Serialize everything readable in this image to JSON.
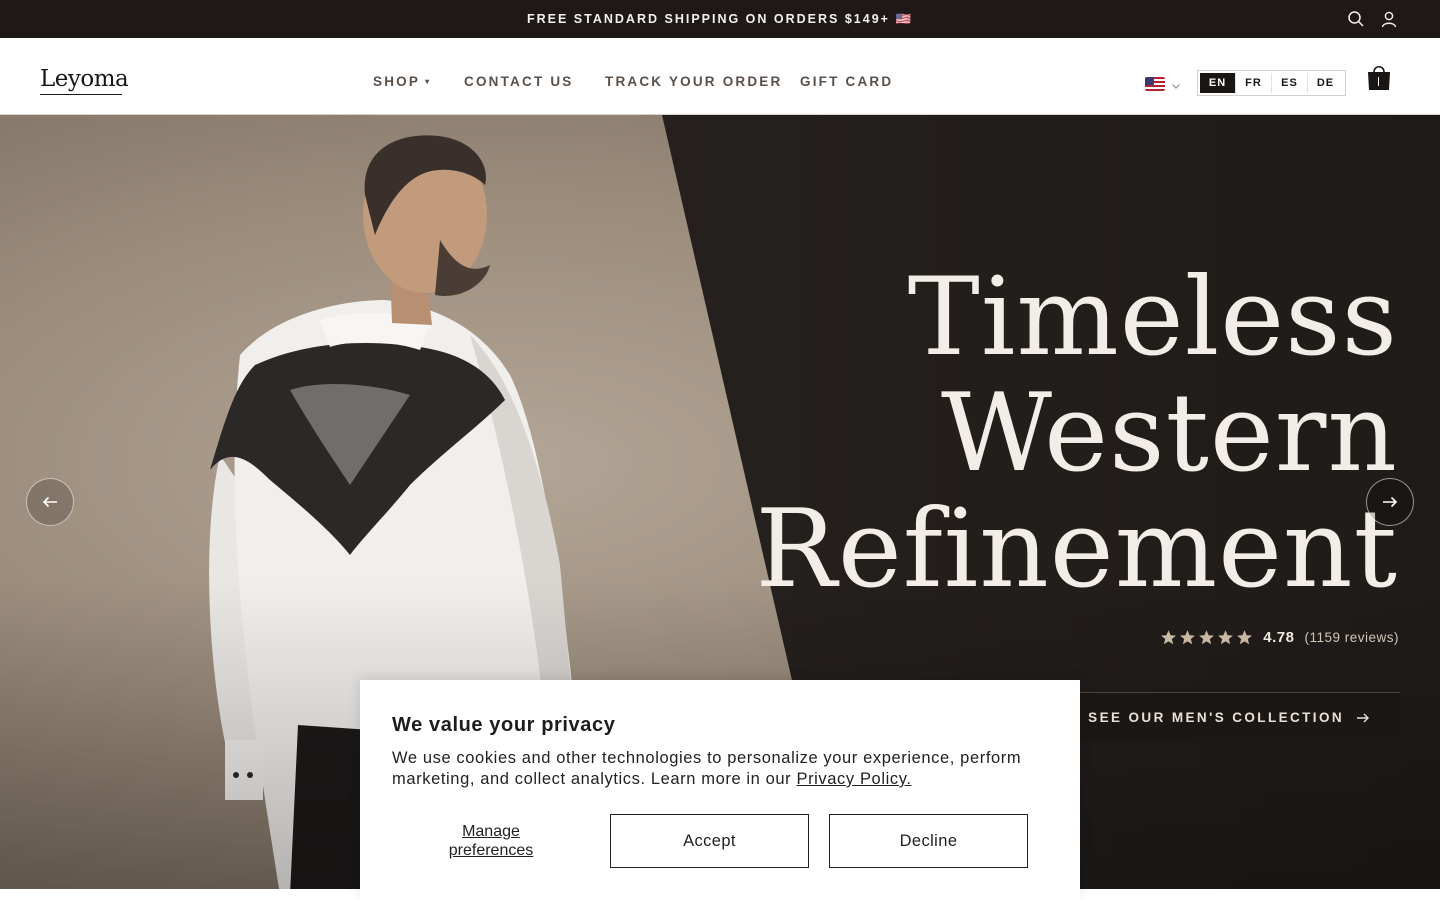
{
  "announcement": {
    "text": "FREE STANDARD SHIPPING ON ORDERS $149+ 🇺🇸"
  },
  "header": {
    "logo": "Leyoma",
    "nav": [
      {
        "label": "SHOP",
        "caret": "▾"
      },
      {
        "label": "CONTACT US"
      },
      {
        "label": "TRACK YOUR ORDER"
      },
      {
        "label": "GIFT CARD"
      }
    ],
    "languages": [
      "EN",
      "FR",
      "ES",
      "DE"
    ],
    "active_language": "EN"
  },
  "hero": {
    "title_lines": [
      "Timeless",
      "Western",
      "Refinement"
    ],
    "rating": {
      "value": "4.78",
      "count": "(1159 reviews)",
      "stars": 5
    },
    "cta_label": "SEE OUR MEN'S COLLECTION"
  },
  "cookie_banner": {
    "title": "We value your privacy",
    "body": "We use cookies and other technologies to personalize your experience, perform marketing, and collect analytics. Learn more in our",
    "link": "Privacy Policy.",
    "manage_label": "Manage preferences",
    "accept_label": "Accept",
    "decline_label": "Decline"
  },
  "colors": {
    "announcement_bg": "#1e1917",
    "hero_dark": "#221e1c",
    "hero_light": "#a89a8a",
    "hero_text": "#f2ede6",
    "star": "#c9b9a4"
  },
  "icons": [
    "search-icon",
    "account-icon",
    "flag-us-icon",
    "chevron-down-icon",
    "cart-bag-icon",
    "arrow-left-icon",
    "arrow-right-icon",
    "star-icon"
  ]
}
